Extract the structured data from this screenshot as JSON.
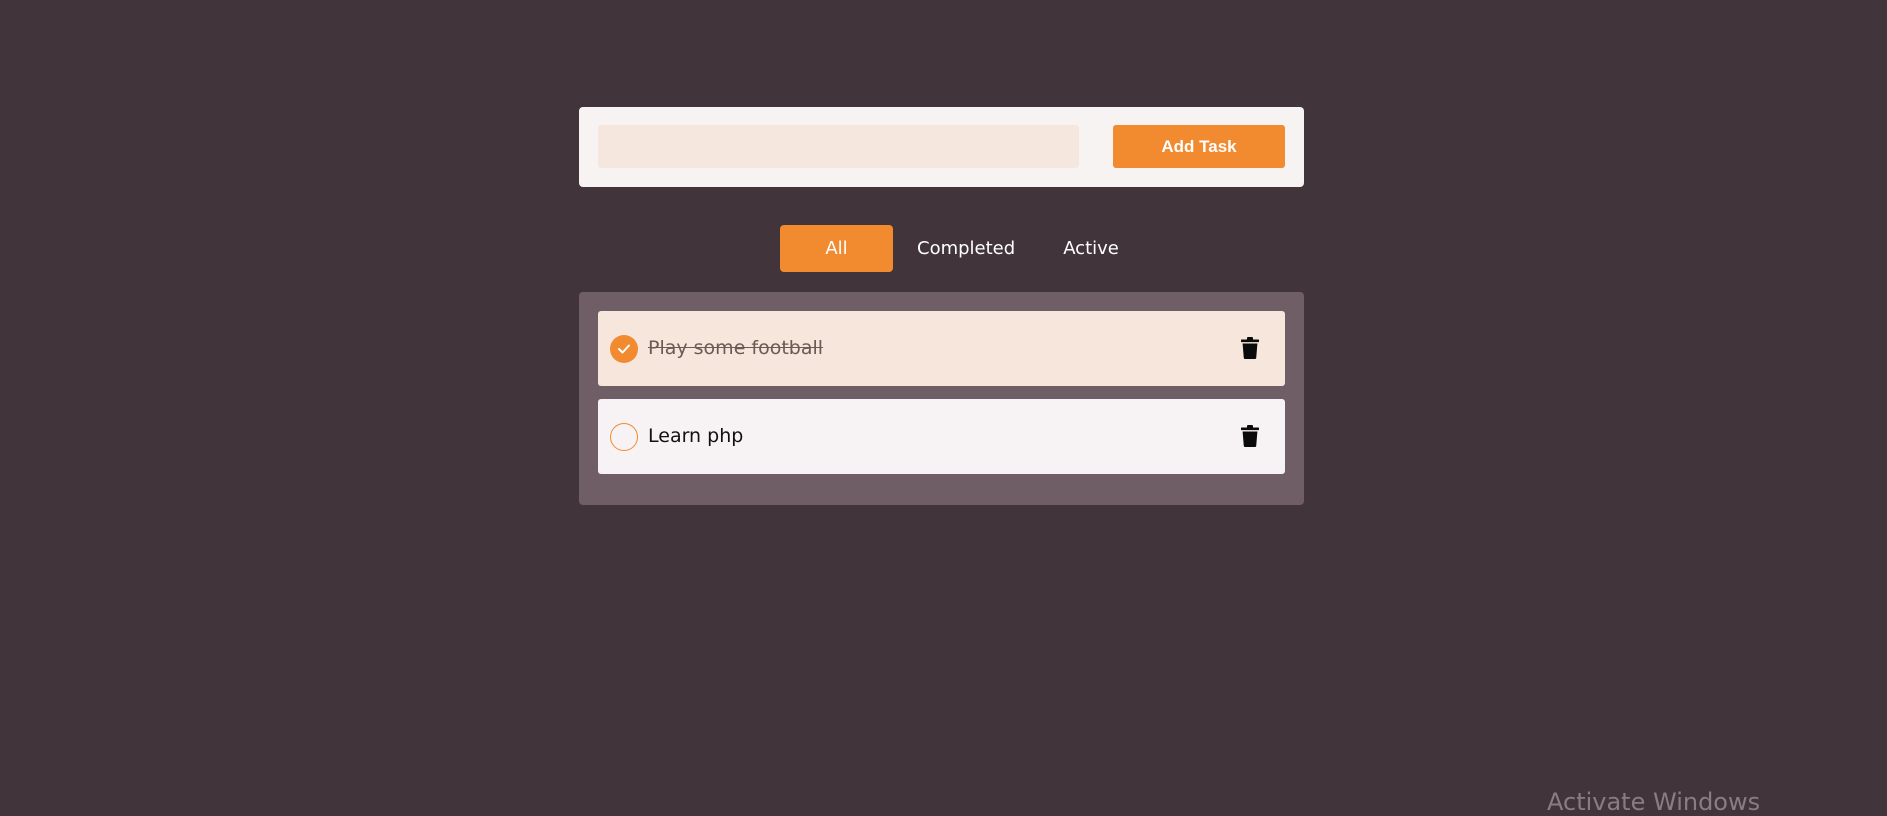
{
  "add_form": {
    "input_value": "",
    "input_placeholder": "",
    "button_label": "Add Task"
  },
  "filters": {
    "tabs": [
      {
        "label": "All",
        "selected": true
      },
      {
        "label": "Completed",
        "selected": false
      },
      {
        "label": "Active",
        "selected": false
      }
    ]
  },
  "tasks": [
    {
      "text": "Play some football",
      "completed": true,
      "delete_icon": "trash-icon"
    },
    {
      "text": "Learn php",
      "completed": false,
      "delete_icon": "trash-icon"
    }
  ],
  "watermark": {
    "text": "Activate Windows"
  },
  "colors": {
    "background": "#41353b",
    "accent": "#f28b30",
    "card": "#f7f3f3",
    "input": "#f6e7de",
    "list_panel": "#6f5e66",
    "completed_row": "#f6e6dc"
  }
}
